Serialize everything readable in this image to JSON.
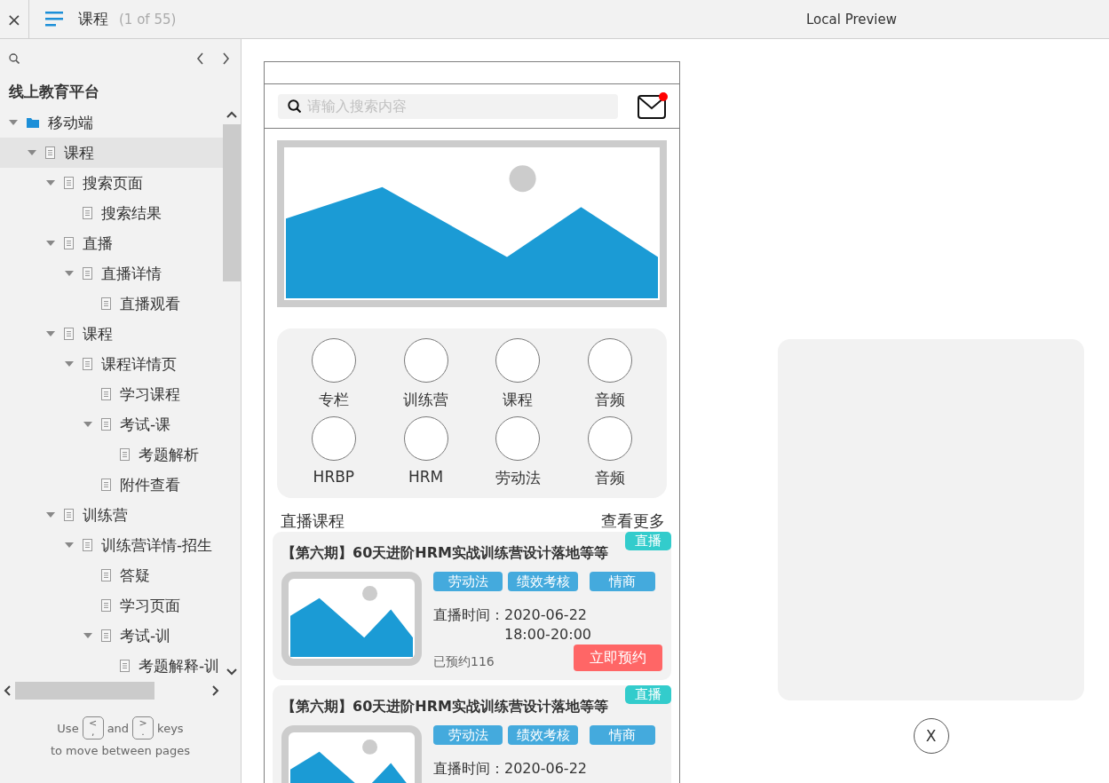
{
  "topbar": {
    "close": "×",
    "title": "课程",
    "page_count": "(1 of 55)",
    "preview_title": "Local Preview"
  },
  "sidebar": {
    "project": "线上教育平台",
    "tree": [
      {
        "label": "移动端",
        "kind": "folder",
        "expanded": true,
        "selected": false,
        "children": [
          {
            "label": "课程",
            "kind": "page",
            "expanded": true,
            "selected": true,
            "children": [
              {
                "label": "搜索页面",
                "kind": "page",
                "expanded": true,
                "selected": false,
                "children": [
                  {
                    "label": "搜索结果",
                    "kind": "page",
                    "selected": false
                  }
                ]
              },
              {
                "label": "直播",
                "kind": "page",
                "expanded": true,
                "selected": false,
                "children": [
                  {
                    "label": "直播详情",
                    "kind": "page",
                    "expanded": true,
                    "selected": false,
                    "children": [
                      {
                        "label": "直播观看",
                        "kind": "page",
                        "selected": false
                      }
                    ]
                  }
                ]
              },
              {
                "label": "课程",
                "kind": "page",
                "expanded": true,
                "selected": false,
                "children": [
                  {
                    "label": "课程详情页",
                    "kind": "page",
                    "expanded": true,
                    "selected": false,
                    "children": [
                      {
                        "label": "学习课程",
                        "kind": "page",
                        "selected": false
                      },
                      {
                        "label": "考试-课",
                        "kind": "page",
                        "expanded": true,
                        "selected": false,
                        "children": [
                          {
                            "label": "考题解析",
                            "kind": "page",
                            "selected": false
                          }
                        ]
                      },
                      {
                        "label": "附件查看",
                        "kind": "page",
                        "selected": false
                      }
                    ]
                  }
                ]
              },
              {
                "label": "训练营",
                "kind": "page",
                "expanded": true,
                "selected": false,
                "children": [
                  {
                    "label": "训练营详情-招生",
                    "kind": "page",
                    "expanded": true,
                    "selected": false,
                    "children": [
                      {
                        "label": "答疑",
                        "kind": "page",
                        "selected": false
                      },
                      {
                        "label": "学习页面",
                        "kind": "page",
                        "selected": false
                      },
                      {
                        "label": "考试-训",
                        "kind": "page",
                        "expanded": true,
                        "selected": false,
                        "children": [
                          {
                            "label": "考题解释-训",
                            "kind": "page",
                            "selected": false
                          }
                        ]
                      }
                    ]
                  }
                ]
              }
            ]
          }
        ]
      }
    ],
    "hint": {
      "use": "Use",
      "prev_key_top": "<",
      "prev_key_bottom": ",",
      "and": "and",
      "next_key_top": ">",
      "next_key_bottom": ".",
      "keys": "keys",
      "line2": "to move between pages"
    }
  },
  "phone": {
    "search_placeholder": "请输入搜索内容",
    "mail_unread": true,
    "categories": [
      "专栏",
      "训练营",
      "课程",
      "音频",
      "HRBP",
      "HRM",
      "劳动法",
      "音频"
    ],
    "section_title": "直播课程",
    "more_link": "查看更多",
    "courses": [
      {
        "title": "【第六期】60天进阶HRM实战训练营设计落地等等",
        "badge": "直播",
        "tags": [
          "劳动法",
          "绩效考核",
          "情商"
        ],
        "time_label": "直播时间：",
        "date": "2020-06-22",
        "time": "18:00-20:00",
        "booked": "已预约116",
        "button": "立即预约"
      },
      {
        "title": "【第六期】60天进阶HRM实战训练营设计落地等等",
        "badge": "直播",
        "tags": [
          "劳动法",
          "绩效考核",
          "情商"
        ],
        "time_label": "直播时间：",
        "date": "2020-06-22"
      }
    ]
  },
  "overlay": {
    "close": "X"
  }
}
